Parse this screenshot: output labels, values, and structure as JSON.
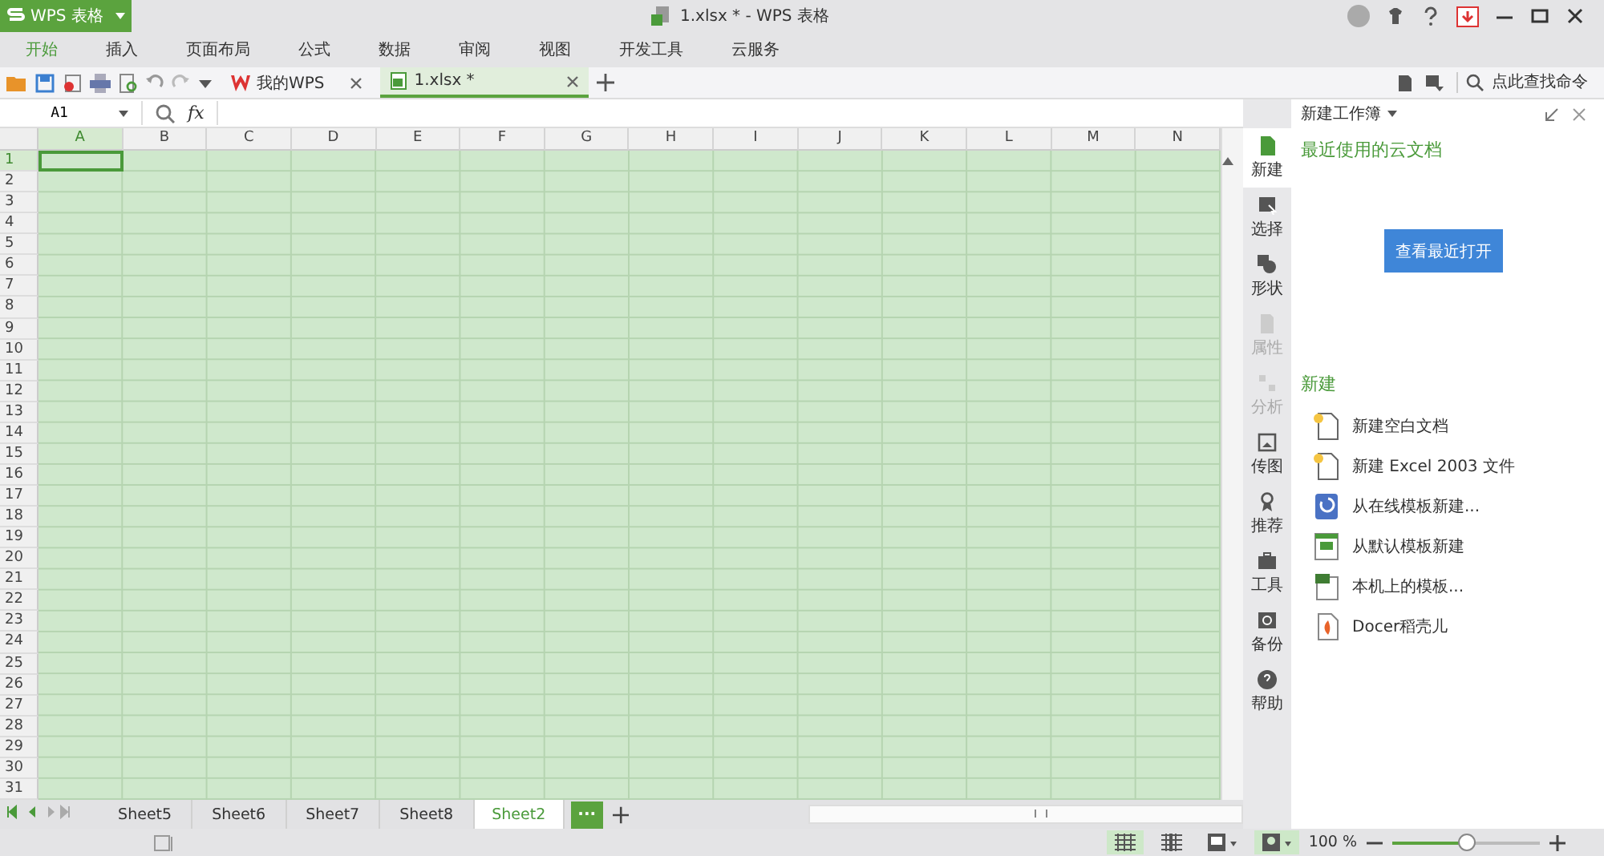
{
  "app_button": {
    "label": "WPS 表格"
  },
  "window": {
    "title": "1.xlsx * - WPS 表格"
  },
  "menu": [
    {
      "label": "开始",
      "selected": true
    },
    {
      "label": "插入",
      "selected": false
    },
    {
      "label": "页面布局",
      "selected": false
    },
    {
      "label": "公式",
      "selected": false
    },
    {
      "label": "数据",
      "selected": false
    },
    {
      "label": "审阅",
      "selected": false
    },
    {
      "label": "视图",
      "selected": false
    },
    {
      "label": "开发工具",
      "selected": false
    },
    {
      "label": "云服务",
      "selected": false
    }
  ],
  "doc_tabs": [
    {
      "label": "我的WPS",
      "selected": false
    },
    {
      "label": "1.xlsx *",
      "selected": true
    }
  ],
  "command_search": {
    "placeholder": "点此查找命令"
  },
  "name_box": {
    "value": "A1"
  },
  "formula": {
    "label": "fx"
  },
  "columns": [
    {
      "label": "A",
      "selected": true
    },
    {
      "label": "B",
      "selected": false
    },
    {
      "label": "C",
      "selected": false
    },
    {
      "label": "D",
      "selected": false
    },
    {
      "label": "E",
      "selected": false
    },
    {
      "label": "F",
      "selected": false
    },
    {
      "label": "G",
      "selected": false
    },
    {
      "label": "H",
      "selected": false
    },
    {
      "label": "I",
      "selected": false
    },
    {
      "label": "J",
      "selected": false
    },
    {
      "label": "K",
      "selected": false
    },
    {
      "label": "L",
      "selected": false
    },
    {
      "label": "M",
      "selected": false
    },
    {
      "label": "N",
      "selected": false
    }
  ],
  "rows": [
    {
      "label": "1",
      "selected": true
    },
    {
      "label": "2",
      "selected": false
    },
    {
      "label": "3",
      "selected": false
    },
    {
      "label": "4",
      "selected": false
    },
    {
      "label": "5",
      "selected": false
    },
    {
      "label": "6",
      "selected": false
    },
    {
      "label": "7",
      "selected": false
    },
    {
      "label": "8",
      "selected": false
    },
    {
      "label": "9",
      "selected": false
    },
    {
      "label": "10",
      "selected": false
    },
    {
      "label": "11",
      "selected": false
    },
    {
      "label": "12",
      "selected": false
    },
    {
      "label": "13",
      "selected": false
    },
    {
      "label": "14",
      "selected": false
    },
    {
      "label": "15",
      "selected": false
    },
    {
      "label": "16",
      "selected": false
    },
    {
      "label": "17",
      "selected": false
    },
    {
      "label": "18",
      "selected": false
    },
    {
      "label": "19",
      "selected": false
    },
    {
      "label": "20",
      "selected": false
    },
    {
      "label": "21",
      "selected": false
    },
    {
      "label": "22",
      "selected": false
    },
    {
      "label": "23",
      "selected": false
    },
    {
      "label": "24",
      "selected": false
    },
    {
      "label": "25",
      "selected": false
    },
    {
      "label": "26",
      "selected": false
    },
    {
      "label": "27",
      "selected": false
    },
    {
      "label": "28",
      "selected": false
    },
    {
      "label": "29",
      "selected": false
    },
    {
      "label": "30",
      "selected": false
    },
    {
      "label": "31",
      "selected": false
    }
  ],
  "sheet_tabs": [
    {
      "label": "Sheet5",
      "selected": false
    },
    {
      "label": "Sheet6",
      "selected": false
    },
    {
      "label": "Sheet7",
      "selected": false
    },
    {
      "label": "Sheet8",
      "selected": false
    },
    {
      "label": "Sheet2",
      "selected": true
    }
  ],
  "sheet_more": {
    "label": "···"
  },
  "side_nav": [
    {
      "label": "新建",
      "kind": "doc",
      "selected": true,
      "disabled": false
    },
    {
      "label": "选择",
      "kind": "select",
      "selected": false,
      "disabled": false
    },
    {
      "label": "形状",
      "kind": "shape",
      "selected": false,
      "disabled": false
    },
    {
      "label": "属性",
      "kind": "props",
      "selected": false,
      "disabled": true
    },
    {
      "label": "分析",
      "kind": "analyze",
      "selected": false,
      "disabled": true
    },
    {
      "label": "传图",
      "kind": "image",
      "selected": false,
      "disabled": false
    },
    {
      "label": "推荐",
      "kind": "award",
      "selected": false,
      "disabled": false
    },
    {
      "label": "工具",
      "kind": "tools",
      "selected": false,
      "disabled": false
    },
    {
      "label": "备份",
      "kind": "backup",
      "selected": false,
      "disabled": false
    },
    {
      "label": "帮助",
      "kind": "help",
      "selected": false,
      "disabled": false
    }
  ],
  "panel": {
    "title": "新建工作簿",
    "cloud_heading": "最近使用的云文档",
    "open_recent_button": "查看最近打开",
    "new_heading": "新建",
    "items": [
      {
        "label": "新建空白文档",
        "kind": "blank"
      },
      {
        "label": "新建 Excel 2003 文件",
        "kind": "blank"
      },
      {
        "label": "从在线模板新建...",
        "kind": "online"
      },
      {
        "label": "从默认模板新建",
        "kind": "sheet"
      },
      {
        "label": "本机上的模板...",
        "kind": "local"
      },
      {
        "label": "Docer稻壳儿",
        "kind": "docer"
      }
    ]
  },
  "zoom": {
    "reading": "100 %",
    "level": 0.5
  }
}
